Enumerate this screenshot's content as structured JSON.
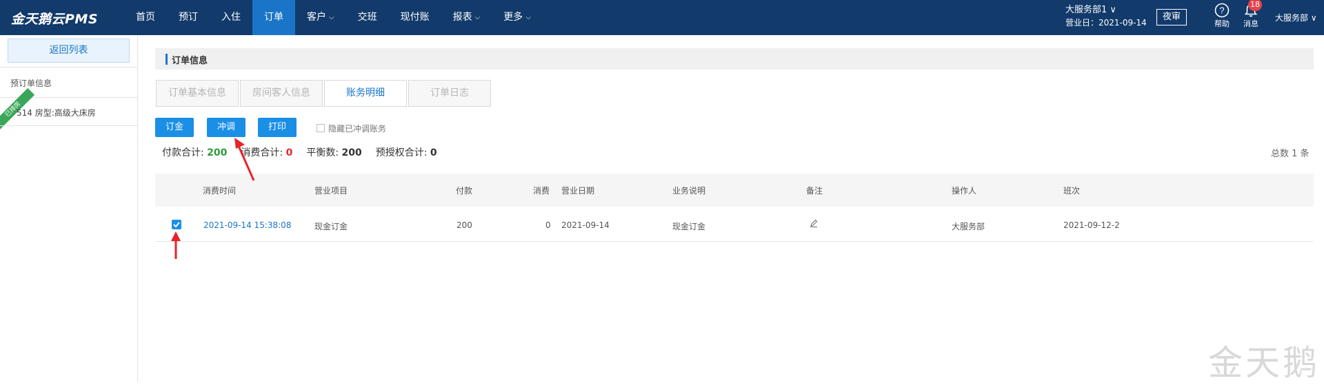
{
  "app": {
    "logo": "金天鹅云PMS"
  },
  "nav": {
    "items": [
      {
        "label": "首页",
        "active": false,
        "caret": false
      },
      {
        "label": "预订",
        "active": false,
        "caret": false
      },
      {
        "label": "入住",
        "active": false,
        "caret": false
      },
      {
        "label": "订单",
        "active": true,
        "caret": false
      },
      {
        "label": "客户",
        "active": false,
        "caret": true
      },
      {
        "label": "交班",
        "active": false,
        "caret": false
      },
      {
        "label": "现付账",
        "active": false,
        "caret": false
      },
      {
        "label": "报表",
        "active": false,
        "caret": true
      },
      {
        "label": "更多",
        "active": false,
        "caret": true
      }
    ],
    "caret_icon": "chevron-down-icon"
  },
  "header": {
    "store_name": "大服务部1 ∨",
    "business_date": "营业日：2021-09-14",
    "night_audit": "夜审",
    "help_label": "帮助",
    "msg_label": "消息",
    "msg_count": "18",
    "user": "大服务部 ∨"
  },
  "sidebar": {
    "back": "返回列表",
    "pre_order_title": "预订单信息",
    "room_status": "已排房",
    "room_text": "514  房型:高级大床房"
  },
  "main": {
    "section_title": "订单信息",
    "tabs": [
      {
        "label": "订单基本信息",
        "active": false
      },
      {
        "label": "房间客人信息",
        "active": false
      },
      {
        "label": "账务明细",
        "active": true
      },
      {
        "label": "订单日志",
        "active": false
      }
    ],
    "buttons": {
      "deposit": "订金",
      "adjust": "冲调",
      "print": "打印"
    },
    "hide_adjusted": "隐藏已冲调账务",
    "totals": {
      "pay_label": "付款合计:",
      "pay_value": "200",
      "consume_label": "消费合计:",
      "consume_value": "0",
      "balance_label": "平衡数:",
      "balance_value": "200",
      "preauth_label": "预授权合计:",
      "preauth_value": "0"
    },
    "total_count": "总数 1 条",
    "table": {
      "headers": [
        "消费时间",
        "营业项目",
        "付款",
        "消费",
        "营业日期",
        "业务说明",
        "备注",
        "操作人",
        "班次"
      ],
      "rows": [
        {
          "checked": true,
          "time": "2021-09-14 15:38:08",
          "item": "现金订金",
          "pay": "200",
          "consume": "0",
          "date": "2021-09-14",
          "desc": "现金订金",
          "note_icon": "pencil-icon",
          "operator": "大服务部",
          "shift": "2021-09-12-2"
        }
      ]
    }
  },
  "watermark": "金天鹅",
  "colors": {
    "topbar": "#123a6b",
    "accent": "#1a75c9",
    "button": "#1a8fe6",
    "annotation_arrow": "#e8232a"
  }
}
